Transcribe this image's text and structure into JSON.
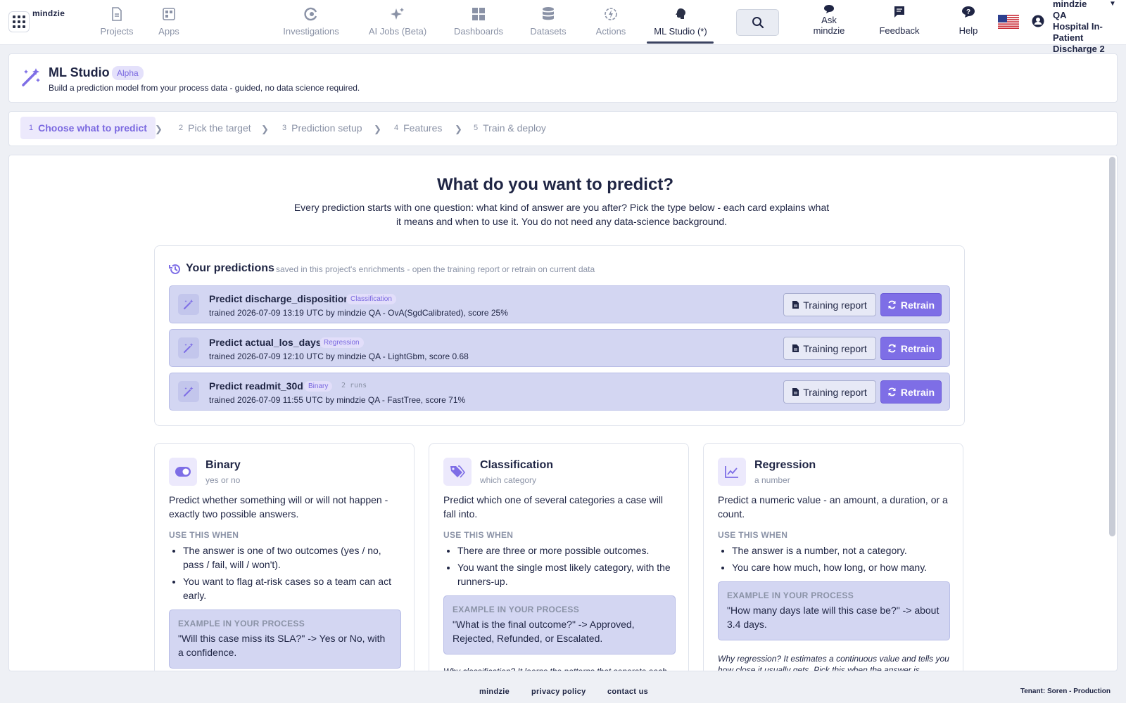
{
  "brand": "mindzie",
  "nav": {
    "projects": "Projects",
    "apps": "Apps",
    "investigations": "Investigations",
    "ai_jobs": "AI Jobs (Beta)",
    "dashboards": "Dashboards",
    "datasets": "Datasets",
    "actions": "Actions",
    "ml_studio": "ML Studio (*)",
    "ask_line1": "Ask",
    "ask_line2": "mindzie",
    "feedback": "Feedback",
    "help": "Help"
  },
  "user": {
    "name_line1": "mindzie",
    "name_line2": "QA",
    "project_line1": "Hospital In-",
    "project_line2": "Patient",
    "project_line3": "Discharge 2"
  },
  "header": {
    "title": "ML Studio",
    "badge": "Alpha",
    "subtitle": "Build a prediction model from your process data - guided, no data science required."
  },
  "steps": [
    {
      "num": "1",
      "label": "Choose what to predict"
    },
    {
      "num": "2",
      "label": "Pick the target"
    },
    {
      "num": "3",
      "label": "Prediction setup"
    },
    {
      "num": "4",
      "label": "Features"
    },
    {
      "num": "5",
      "label": "Train & deploy"
    }
  ],
  "main": {
    "title": "What do you want to predict?",
    "description": "Every prediction starts with one question: what kind of answer are you after? Pick the type below - each card explains what it means and when to use it. You do not need any data-science background."
  },
  "predictions": {
    "title": "Your predictions",
    "subtitle": "saved in this project's enrichments - open the training report or retrain on current data",
    "report_label": "Training report",
    "retrain_label": "Retrain",
    "items": [
      {
        "name": "Predict discharge_disposition",
        "tag": "Classification",
        "runs": "",
        "meta": "trained 2026-07-09 13:19 UTC by mindzie QA - OvA(SgdCalibrated), score 25%"
      },
      {
        "name": "Predict actual_los_days",
        "tag": "Regression",
        "runs": "",
        "meta": "trained 2026-07-09 12:10 UTC by mindzie QA - LightGbm, score 0.68"
      },
      {
        "name": "Predict readmit_30d",
        "tag": "Binary",
        "runs": "2 runs",
        "meta": "trained 2026-07-09 11:55 UTC by mindzie QA - FastTree, score 71%"
      }
    ]
  },
  "types": {
    "use_when_label": "USE THIS WHEN",
    "example_label": "EXAMPLE IN YOUR PROCESS",
    "binary": {
      "title": "Binary",
      "subtitle": "yes or no",
      "description": "Predict whether something will or will not happen - exactly two possible answers.",
      "bullets": [
        "The answer is one of two outcomes (yes / no, pass / fail, will / won't).",
        "You want to flag at-risk cases so a team can act early."
      ],
      "example": "\"Will this case miss its SLA?\"  ->  Yes or No, with a confidence."
    },
    "classification": {
      "title": "Classification",
      "subtitle": "which category",
      "description": "Predict which one of several categories a case will fall into.",
      "bullets": [
        "There are three or more possible outcomes.",
        "You want the single most likely category, with the runners-up."
      ],
      "example": "\"What is the final outcome?\"  ->  Approved, Rejected, Refunded, or Escalated.",
      "why": "Why classification? It learns the patterns that separate each"
    },
    "regression": {
      "title": "Regression",
      "subtitle": "a number",
      "description": "Predict a numeric value - an amount, a duration, or a count.",
      "bullets": [
        "The answer is a number, not a category.",
        "You care how much, how long, or how many."
      ],
      "example": "\"How many days late will this case be?\"  ->  about 3.4 days.",
      "why": "Why regression? It estimates a continuous value and tells you how close it usually gets. Pick this when the answer is"
    }
  },
  "footer": {
    "brand": "mindzie",
    "privacy": "privacy policy",
    "contact": "contact us",
    "tenant": "Tenant: Soren - Production"
  },
  "colors": {
    "accent": "#7e6ee6",
    "accent_light": "#ece9fc",
    "row_bg": "#d3d6f2",
    "text": "#1f2544",
    "muted": "#8a92a6"
  }
}
